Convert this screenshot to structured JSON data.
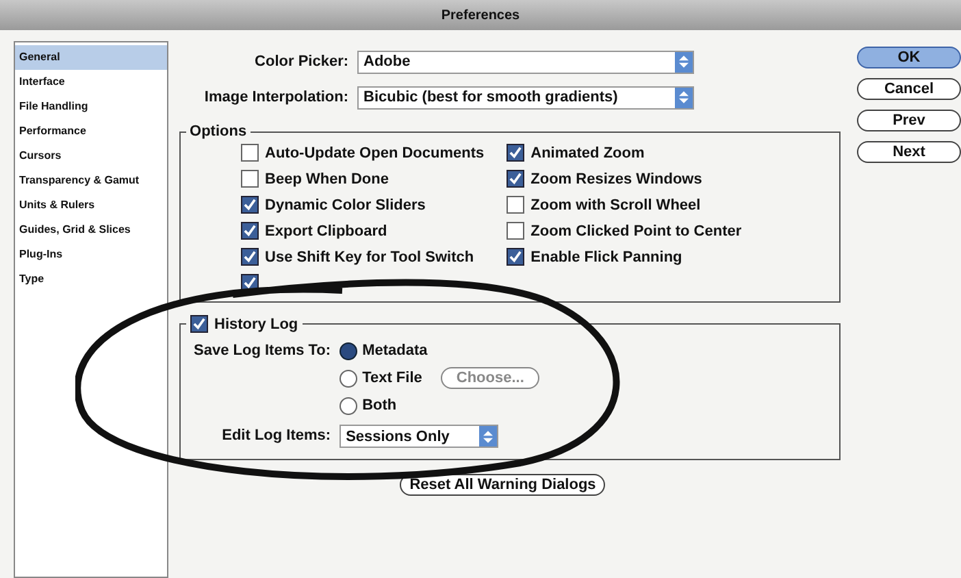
{
  "window": {
    "title": "Preferences"
  },
  "sidebar": {
    "items": [
      {
        "label": "General",
        "selected": true
      },
      {
        "label": "Interface",
        "selected": false
      },
      {
        "label": "File Handling",
        "selected": false
      },
      {
        "label": "Performance",
        "selected": false
      },
      {
        "label": "Cursors",
        "selected": false
      },
      {
        "label": "Transparency & Gamut",
        "selected": false
      },
      {
        "label": "Units & Rulers",
        "selected": false
      },
      {
        "label": "Guides, Grid & Slices",
        "selected": false
      },
      {
        "label": "Plug-Ins",
        "selected": false
      },
      {
        "label": "Type",
        "selected": false
      }
    ]
  },
  "color_picker": {
    "label": "Color Picker:",
    "value": "Adobe"
  },
  "image_interpolation": {
    "label": "Image Interpolation:",
    "value": "Bicubic (best for smooth gradients)"
  },
  "options": {
    "title": "Options",
    "columns": [
      [
        {
          "label": "Auto-Update Open Documents",
          "checked": false
        },
        {
          "label": "Beep When Done",
          "checked": false
        },
        {
          "label": "Dynamic Color Sliders",
          "checked": true
        },
        {
          "label": "Export Clipboard",
          "checked": true
        },
        {
          "label": "Use Shift Key for Tool Switch",
          "checked": true
        },
        {
          "checked": true
        }
      ],
      [
        {
          "label": "Animated Zoom",
          "checked": true
        },
        {
          "label": "Zoom Resizes Windows",
          "checked": true
        },
        {
          "label": "Zoom with Scroll Wheel",
          "checked": false
        },
        {
          "label": "Zoom Clicked Point to Center",
          "checked": false
        },
        {
          "label": "Enable Flick Panning",
          "checked": true
        }
      ]
    ]
  },
  "history_log": {
    "label": "History Log",
    "checked": true,
    "save_to_label": "Save Log Items To:",
    "save_to": [
      {
        "label": "Metadata",
        "selected": true
      },
      {
        "label": "Text File",
        "selected": false
      },
      {
        "label": "Both",
        "selected": false
      }
    ],
    "choose_button": "Choose...",
    "edit_label": "Edit Log Items:",
    "edit_value": "Sessions Only"
  },
  "reset_button": "Reset All Warning Dialogs",
  "buttons": [
    {
      "label": "OK",
      "default": true
    },
    {
      "label": "Cancel",
      "default": false
    },
    {
      "label": "Prev",
      "default": false
    },
    {
      "label": "Next",
      "default": false
    }
  ]
}
